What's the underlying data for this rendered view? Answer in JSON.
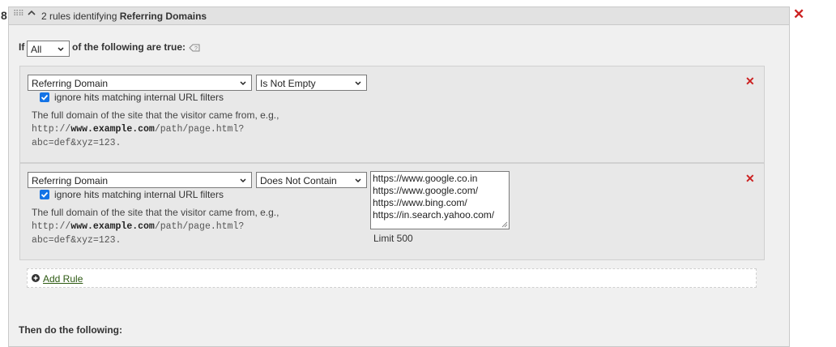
{
  "rule_number": "8",
  "header": {
    "title_prefix": "2 rules identifying",
    "title_bold": "Referring Domains"
  },
  "condition": {
    "if_label": "If",
    "match_value": "All",
    "suffix_label": "of the following are true:"
  },
  "rules": [
    {
      "field": "Referring Domain",
      "operator": "Is Not Empty",
      "checkbox_checked": true,
      "checkbox_label": "ignore hits matching internal URL filters",
      "desc_text": "The full domain of the site that the visitor came from, e.g.,",
      "desc_code_1": "http://",
      "desc_code_bold": "www.example.com",
      "desc_code_2": "/path/page.html?",
      "desc_code_3": "abc=def&xyz=123."
    },
    {
      "field": "Referring Domain",
      "operator": "Does Not Contain",
      "checkbox_checked": true,
      "checkbox_label": "ignore hits matching internal URL filters",
      "desc_text": "The full domain of the site that the visitor came from, e.g.,",
      "desc_code_1": "http://",
      "desc_code_bold": "www.example.com",
      "desc_code_2": "/path/page.html?",
      "desc_code_3": "abc=def&xyz=123.",
      "values": [
        "https://www.google.co.in",
        "https://www.google.com/",
        "https://www.bing.com/",
        "https://in.search.yahoo.com/"
      ],
      "limit_label": "Limit 500"
    }
  ],
  "add_rule_label": "Add Rule",
  "then_label": "Then do the following:",
  "icons": {
    "remove": "close-icon",
    "collapse": "chevron-up-icon",
    "drag": "drag-handle-icon",
    "help": "help-icon",
    "add": "plus-circle-icon"
  },
  "colors": {
    "remove": "#cc2222",
    "checkbox": "#1473e6",
    "link": "#2d5a12"
  }
}
